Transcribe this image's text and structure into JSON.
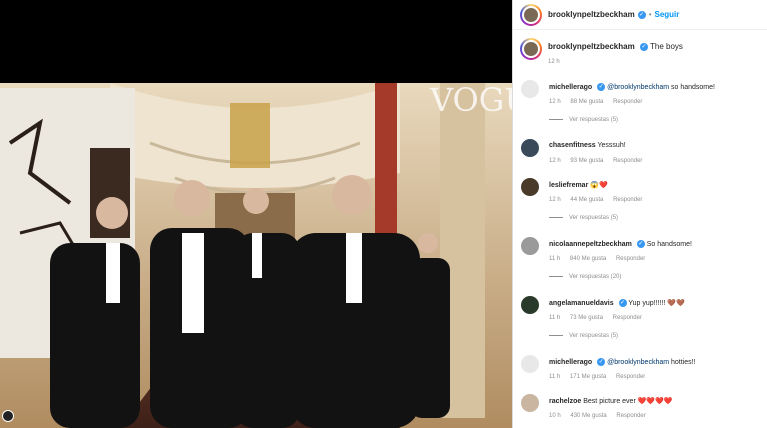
{
  "media": {
    "watermark": "VOGUE"
  },
  "header": {
    "username": "brooklynpeltzbeckham",
    "dot": "•",
    "follow_label": "Seguir"
  },
  "caption": {
    "username": "brooklynpeltzbeckham",
    "text": "The boys",
    "time": "12 h"
  },
  "comments": [
    {
      "username": "michellerago",
      "mention": "@brooklynbeckham",
      "text": " so handsome!",
      "time": "12 h",
      "likes": "88 Me gusta",
      "reply": "Responder",
      "replies": "Ver respuestas (5)"
    },
    {
      "username": "chasenfitness",
      "text": "Yesssuh!",
      "time": "12 h",
      "likes": "93 Me gusta",
      "reply": "Responder"
    },
    {
      "username": "lesliefremar",
      "text": "😱❤️",
      "time": "12 h",
      "likes": "44 Me gusta",
      "reply": "Responder",
      "replies": "Ver respuestas (5)"
    },
    {
      "username": "nicolaannepeltzbeckham",
      "text": "So handsome!",
      "time": "11 h",
      "likes": "840 Me gusta",
      "reply": "Responder",
      "replies": "Ver respuestas (20)"
    },
    {
      "username": "angelamanueldavis",
      "text": "Yup yup!!!!!! 🤎🤎",
      "time": "11 h",
      "likes": "73 Me gusta",
      "reply": "Responder",
      "replies": "Ver respuestas (5)"
    },
    {
      "username": "michellerago",
      "mention": "@brooklynbeckham",
      "text": " hotties!!",
      "time": "11 h",
      "likes": "171 Me gusta",
      "reply": "Responder"
    },
    {
      "username": "rachelzoe",
      "text": "Best picture ever ❤️❤️❤️❤️",
      "time": "10 h",
      "likes": "430 Me gusta",
      "reply": "Responder"
    }
  ],
  "colors": {
    "link_blue": "#0095f6",
    "verified_blue": "#3897f0",
    "muted_text": "#8e8e8e"
  }
}
